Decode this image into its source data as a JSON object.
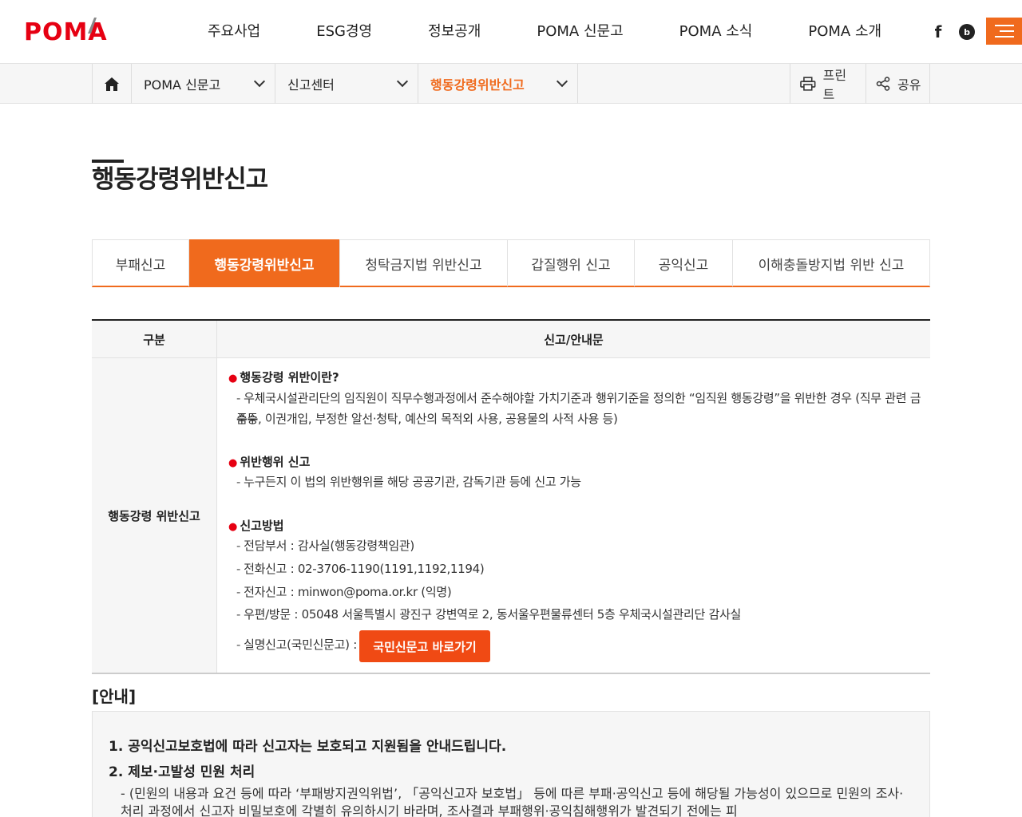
{
  "header": {
    "logo": "POMA",
    "gnb": [
      "주요사업",
      "ESG경영",
      "정보공개",
      "POMA 신문고",
      "POMA 소식",
      "POMA 소개"
    ],
    "sns_facebook": "f",
    "sns_blog": "b"
  },
  "location": {
    "depth1": "POMA 신문고",
    "depth2": "신고센터",
    "depth3": "행동강령위반신고",
    "print_label": "프린트",
    "share_label": "공유"
  },
  "page_title": "행동강령위반신고",
  "tabs": [
    "부패신고",
    "행동강령위반신고",
    "청탁금지법 위반신고",
    "갑질행위 신고",
    "공익신고",
    "이해충돌방지법 위반 신고"
  ],
  "table": {
    "col1_header": "구분",
    "col2_header": "신고/안내문",
    "row_label": "행동강령 위반신고",
    "sec1_title": "행동강령 위반이란?",
    "sec1_line1": "우체국시설관리단의 임직원이 직무수행과정에서 준수해야할 가치기준과 행위기준을 정의한 “임직원 행동강령”을 위반한 경우 (직무 관련 금품등",
    "sec1_line2": "수수, 이권개입, 부정한 알선·청탁, 예산의 목적외 사용, 공용물의 사적 사용 등)",
    "sec2_title": "위반행위 신고",
    "sec2_line1": "누구든지 이 법의 위반행위를 해당 공공기관, 감독기관 등에 신고 가능",
    "sec3_title": "신고방법",
    "sec3_line1": "전담부서 : 감사실(행동강령책임관)",
    "sec3_line2": "전화신고 : 02-3706-1190(1191,1192,1194)",
    "sec3_line3": "전자신고 : minwon@poma.or.kr (익명)",
    "sec3_line4": "우편/방문 : 05048 서울특별시 광진구 강변역로 2, 동서울우편물류센터 5층 우체국시설관리단 감사실",
    "sec3_line5": "실명신고(국민신문고) :",
    "button_label": "국민신문고 바로가기"
  },
  "notice": {
    "heading": "[안내]",
    "item1": "1. 공익신고보호법에 따라 신고자는 보호되고 지원됨을 안내드립니다.",
    "item2": "2. 제보·고발성 민원 처리",
    "item2_detail": "- (민원의 내용과 요건 등에 따라 ‘부패방지권익위법’, 「공익신고자 보호법」 등에 따른 부패·공익신고 등에 해당될 가능성이 있으므로 민원의 조사·처리 과정에서 신고자 비밀보호에 각별히 유의하시기 바라며, 조사결과 부패행위·공익침해행위가 발견되기 전에는 피"
  },
  "colors": {
    "accent": "#f06a1d",
    "brand_red": "#e60012",
    "button": "#f04a14"
  }
}
